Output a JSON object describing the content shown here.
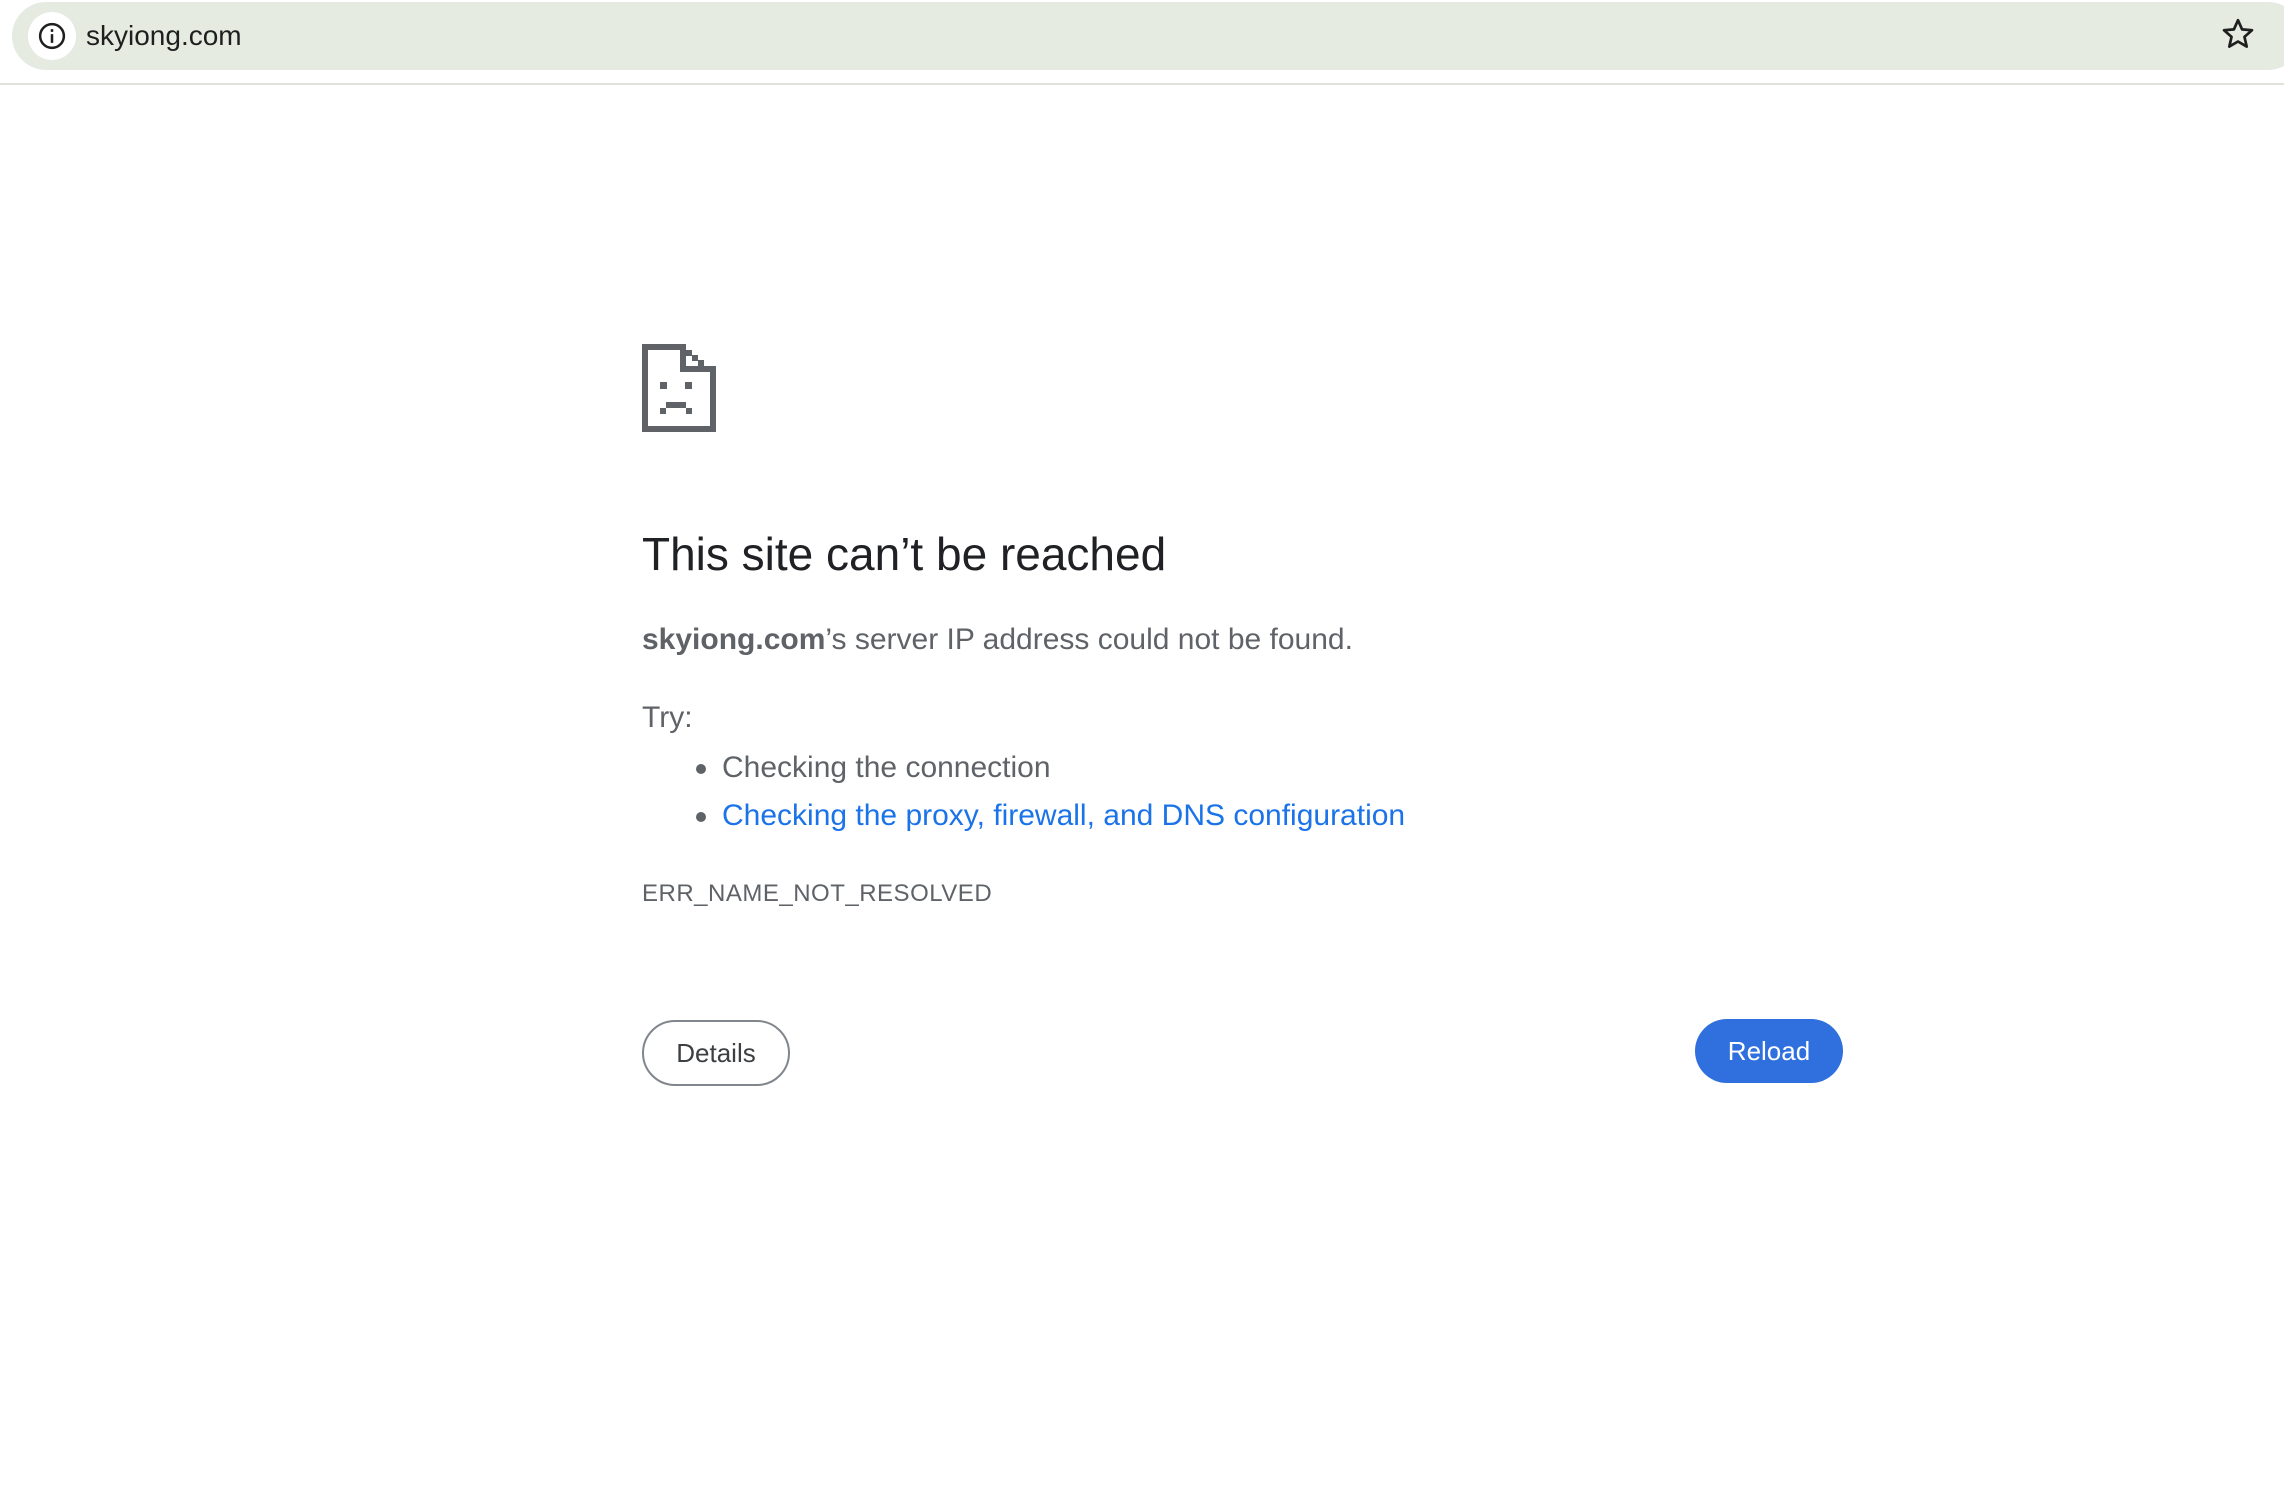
{
  "browser": {
    "url": "skyiong.com",
    "site_info_icon": "info-circle-icon",
    "bookmark_icon": "star-outline-icon"
  },
  "error_page": {
    "icon": "sad-document-icon",
    "title": "This site can’t be reached",
    "summary_host": "skyiong.com",
    "summary_rest": "’s server IP address could not be found.",
    "try_label": "Try:",
    "suggestions": [
      "Checking the connection",
      "Checking the proxy, firewall, and DNS configuration"
    ],
    "error_code": "ERR_NAME_NOT_RESOLVED",
    "details_label": "Details",
    "reload_label": "Reload"
  },
  "colors": {
    "omnibox_bg": "#e5ebe1",
    "link": "#1a73e8",
    "reload_bg": "#2f6fde",
    "text_secondary": "#5f6368",
    "title": "#202124"
  }
}
